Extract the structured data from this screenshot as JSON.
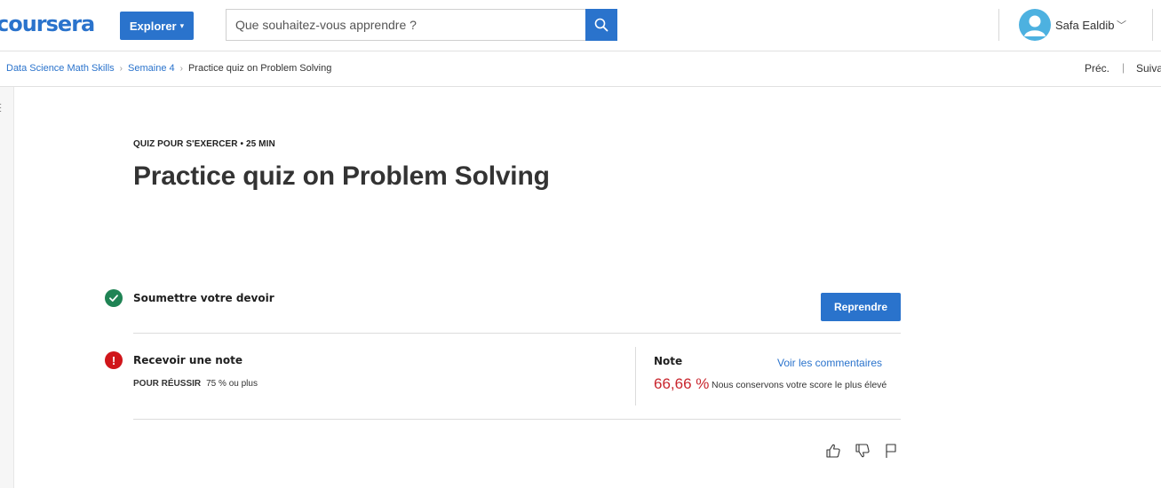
{
  "header": {
    "logo_text": "coursera",
    "explore_label": "Explorer",
    "search": {
      "placeholder": "Que souhaitez-vous apprendre ?",
      "value": ""
    },
    "search_icon": "search-icon",
    "user": {
      "name": "Safa Ealdib",
      "avatar_icon": "user-avatar-icon"
    }
  },
  "breadcrumb": {
    "items": [
      "Data Science Math Skills",
      "Semaine 4",
      "Practice quiz on Problem Solving"
    ],
    "prev_label": "Préc.",
    "separator": "|",
    "next_label": "Suiva"
  },
  "quiz": {
    "kicker": "QUIZ POUR S'EXERCER • 25  MIN",
    "title": "Practice quiz on Problem Solving",
    "submit": {
      "label": "Soumettre votre devoir",
      "status_icon": "check-circle-icon"
    },
    "retake_label": "Reprendre",
    "grade": {
      "label": "Recevoir une note",
      "status_icon": "alert-circle-icon",
      "pass_key": "POUR RÉUSSIR",
      "pass_value": "75 % ou plus"
    },
    "note": {
      "label": "Note",
      "feedback_link": "Voir les commentaires",
      "score": "66,66 %",
      "score_note": "Nous conservons votre score le plus élevé"
    }
  },
  "feedback_icons": [
    "thumbs-up-icon",
    "thumbs-down-icon",
    "flag-icon"
  ],
  "colors": {
    "brand_blue": "#2a73cc",
    "success_green": "#1f8354",
    "error_red": "#d0151a",
    "score_red": "#c9252d"
  }
}
